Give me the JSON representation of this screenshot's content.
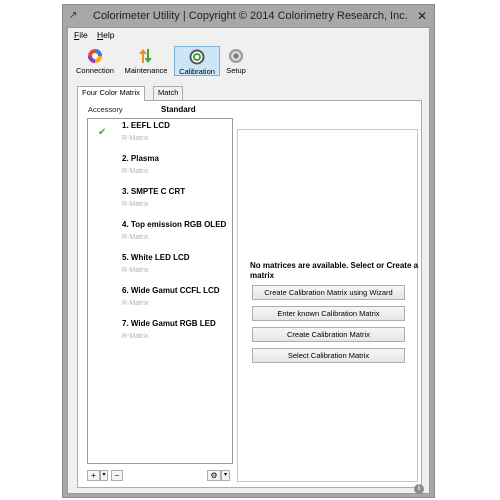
{
  "window": {
    "title": "Colorimeter Utility | Copyright © 2014 Colorimetry Research, Inc."
  },
  "menu": [
    {
      "label": "File",
      "mnemonic": "F",
      "rest": "ile"
    },
    {
      "label": "Help",
      "mnemonic": "H",
      "rest": "elp"
    }
  ],
  "toolbar": [
    {
      "label": "Connection",
      "icon": "connection-icon"
    },
    {
      "label": "Maintenance",
      "icon": "maintenance-icon"
    },
    {
      "label": "Calibration",
      "icon": "calibration-icon",
      "active": true
    },
    {
      "label": "Setup",
      "icon": "setup-icon"
    }
  ],
  "tabs": [
    {
      "label": "Four Color Matrix",
      "active": true
    },
    {
      "label": "Match",
      "active": false
    }
  ],
  "accessory": {
    "label": "Accessory",
    "value": "Standard"
  },
  "matrices": [
    {
      "name": "1. EEFL LCD",
      "sub": "R-Matrix",
      "selected": true
    },
    {
      "name": "2. Plasma",
      "sub": "R-Matrix",
      "selected": false
    },
    {
      "name": "3. SMPTE C CRT",
      "sub": "R-Matrix",
      "selected": false
    },
    {
      "name": "4. Top emission RGB OLED",
      "sub": "R-Matrix",
      "selected": false
    },
    {
      "name": "5. White LED LCD",
      "sub": "R-Matrix",
      "selected": false
    },
    {
      "name": "6. Wide Gamut CCFL LCD",
      "sub": "R-Matrix",
      "selected": false
    },
    {
      "name": "7. Wide Gamut RGB LED",
      "sub": "R-Matrix",
      "selected": false
    }
  ],
  "list_tools": {
    "add": "+",
    "add_dropdown": "▾",
    "remove": "−",
    "gear": "⚙",
    "gear_dropdown": "▾"
  },
  "right_panel": {
    "message": "No matrices are available. Select or Create a matrix",
    "buttons": [
      "Create Calibration Matrix using Wizard",
      "Enter known Calibration Matrix",
      "Create Calibration Matrix",
      "Select Calibration Matrix"
    ]
  },
  "status": {
    "info_icon": "info-icon"
  },
  "colors": {
    "active_tab_bg": "#cde6f7",
    "check": "#4caa3c",
    "sub_text": "#b3b3b3"
  }
}
